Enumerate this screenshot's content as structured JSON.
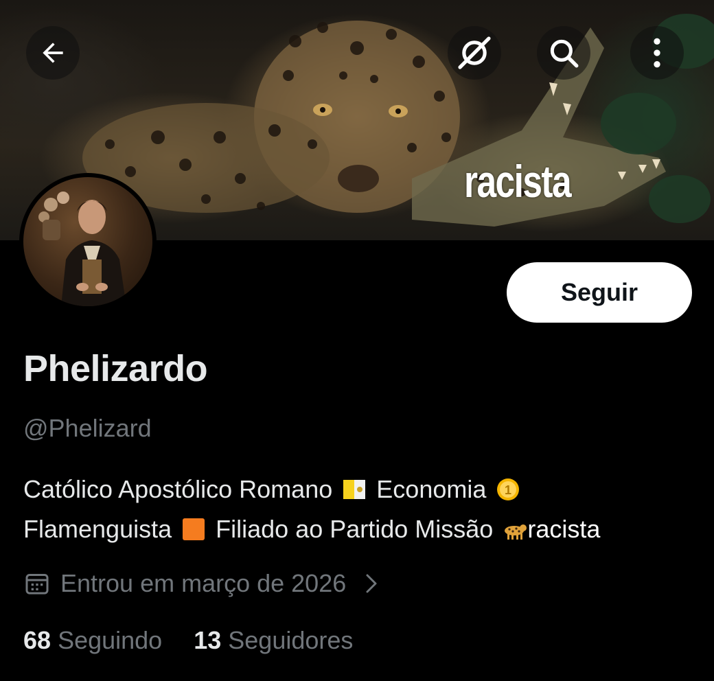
{
  "header": {
    "back_icon": "arrow-left-icon",
    "spaces_icon": "no-signal-icon",
    "search_icon": "search-icon",
    "more_icon": "more-vertical-icon"
  },
  "banner": {
    "overlay_text": "racista"
  },
  "profile": {
    "display_name": "Phelizardo",
    "handle": "@Phelizard",
    "follow_label": "Seguir",
    "bio": {
      "line1_part1": "Católico Apostólico Romano",
      "line1_emoji1": "vatican-flag-emoji",
      "line1_part2": "Economia",
      "line1_emoji2": "coin-emoji",
      "line2_part1": "Flamenguista",
      "line2_emoji1": "orange-square-emoji",
      "line2_part2": "Filiado ao Partido Missão",
      "line2_emoji2": "leopard-emoji",
      "line2_part3": "racista"
    },
    "joined": "Entrou em março de 2026",
    "following_count": "68",
    "following_label": "Seguindo",
    "followers_count": "13",
    "followers_label": "Seguidores"
  },
  "colors": {
    "background": "#000000",
    "primary_text": "#e7e9ea",
    "secondary_text": "#71767b",
    "button_bg": "#ffffff",
    "button_text": "#0f1419"
  }
}
